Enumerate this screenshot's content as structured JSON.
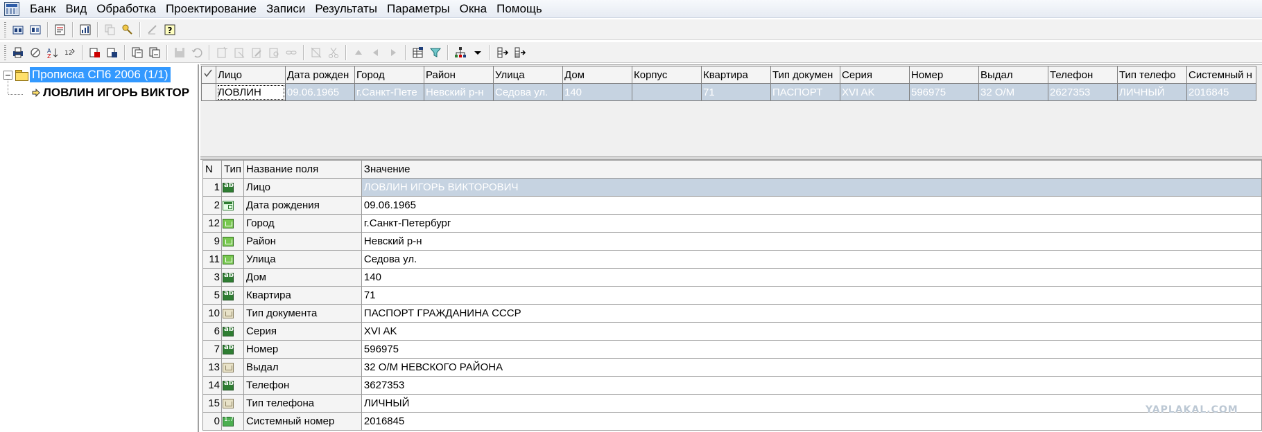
{
  "menu": {
    "items": [
      "Банк",
      "Вид",
      "Обработка",
      "Проектирование",
      "Записи",
      "Результаты",
      "Параметры",
      "Окна",
      "Помощь"
    ]
  },
  "tree": {
    "root_label": "Прописка СП6 2006 (1/1)",
    "child_label": "ЛОВЛИН ИГОРЬ ВИКТОР"
  },
  "records": {
    "columns": [
      "Лицо",
      "Дата рожден",
      "Город",
      "Район",
      "Улица",
      "Дом",
      "Корпус",
      "Квартира",
      "Тип докумен",
      "Серия",
      "Номер",
      "Выдал",
      "Телефон",
      "Тип телефо",
      "Системный н"
    ],
    "rows": [
      [
        "ЛОВЛИН",
        "09.06.1965",
        "г.Санкт-Пете",
        "Невский р-н",
        "Седова ул.",
        "140",
        "",
        "71",
        "ПАСПОРТ",
        "XVI AK",
        "596975",
        "32 О/М",
        "2627353",
        "ЛИЧНЫЙ",
        "2016845"
      ]
    ]
  },
  "fields": {
    "columns": {
      "n": "N",
      "type": "Тип",
      "name": "Название поля",
      "value": "Значение"
    },
    "rows": [
      {
        "n": "1",
        "type_icon": "text-field-icon",
        "name": "Лицо",
        "value": "ЛОВЛИН ИГОРЬ ВИКТОРОВИЧ",
        "highlight": true
      },
      {
        "n": "2",
        "type_icon": "date-field-icon",
        "name": "Дата рождения",
        "value": "09.06.1965"
      },
      {
        "n": "12",
        "type_icon": "dictionary-icon",
        "name": "Город",
        "value": "г.Санкт-Петербург"
      },
      {
        "n": "9",
        "type_icon": "dictionary-icon",
        "name": "Район",
        "value": "Невский р-н"
      },
      {
        "n": "11",
        "type_icon": "dictionary-icon",
        "name": "Улица",
        "value": "Седова ул."
      },
      {
        "n": "3",
        "type_icon": "text-field-icon",
        "name": "Дом",
        "value": "140"
      },
      {
        "n": "5",
        "type_icon": "text-field-icon",
        "name": "Квартира",
        "value": "71"
      },
      {
        "n": "10",
        "type_icon": "dictionary-grey-icon",
        "name": "Тип документа",
        "value": "ПАСПОРТ ГРАЖДАНИНА СССР"
      },
      {
        "n": "6",
        "type_icon": "text-field-icon",
        "name": "Серия",
        "value": "XVI AK"
      },
      {
        "n": "7",
        "type_icon": "text-field-icon",
        "name": "Номер",
        "value": "596975"
      },
      {
        "n": "13",
        "type_icon": "dictionary-grey-icon",
        "name": "Выдал",
        "value": "32 О/М НЕВСКОГО РАЙОНА"
      },
      {
        "n": "14",
        "type_icon": "text-field-icon",
        "name": "Телефон",
        "value": "3627353"
      },
      {
        "n": "15",
        "type_icon": "dictionary-grey-icon",
        "name": "Тип телефона",
        "value": "ЛИЧНЫЙ"
      },
      {
        "n": "0",
        "type_icon": "number-field-icon",
        "name": "Системный номер",
        "value": "2016845"
      }
    ]
  },
  "watermark": "YAPLAKAL.COM",
  "colors": {
    "selection_blue": "#3399ff",
    "row_highlight": "#c6d3e1"
  }
}
